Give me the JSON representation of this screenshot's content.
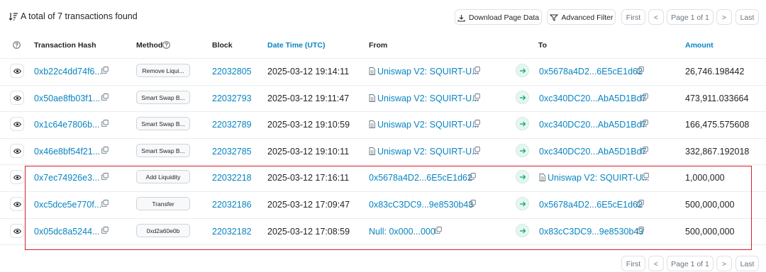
{
  "header": {
    "summary": "A total of 7 transactions found",
    "download_label": "Download Page Data",
    "filter_label": "Advanced Filter",
    "first_label": "First",
    "prev_label": "<",
    "page_label": "Page 1 of 1",
    "next_label": ">",
    "last_label": "Last"
  },
  "columns": {
    "hash": "Transaction Hash",
    "method": "Method",
    "block": "Block",
    "datetime": "Date Time (UTC)",
    "from": "From",
    "to": "To",
    "amount": "Amount"
  },
  "rows": [
    {
      "hash": "0xb22c4dd74f6...",
      "method": "Remove Liqui...",
      "block": "22032805",
      "time": "2025-03-12 19:14:11",
      "from": "Uniswap V2: SQUIRT-U...",
      "from_contract": true,
      "to": "0x5678a4D2...6E5cE1d62",
      "to_contract": false,
      "amount": "26,746.198442"
    },
    {
      "hash": "0x50ae8fb03f1...",
      "method": "Smart Swap B...",
      "block": "22032793",
      "time": "2025-03-12 19:11:47",
      "from": "Uniswap V2: SQUIRT-U...",
      "from_contract": true,
      "to": "0xc340DC20...AbA5D1Bd7",
      "to_contract": false,
      "amount": "473,911.033664"
    },
    {
      "hash": "0x1c64e7806b...",
      "method": "Smart Swap B...",
      "block": "22032789",
      "time": "2025-03-12 19:10:59",
      "from": "Uniswap V2: SQUIRT-U...",
      "from_contract": true,
      "to": "0xc340DC20...AbA5D1Bd7",
      "to_contract": false,
      "amount": "166,475.575608"
    },
    {
      "hash": "0x46e8bf54f21...",
      "method": "Smart Swap B...",
      "block": "22032785",
      "time": "2025-03-12 19:10:11",
      "from": "Uniswap V2: SQUIRT-U...",
      "from_contract": true,
      "to": "0xc340DC20...AbA5D1Bd7",
      "to_contract": false,
      "amount": "332,867.192018"
    },
    {
      "hash": "0x7ec74926e3...",
      "method": "Add Liquidity",
      "block": "22032218",
      "time": "2025-03-12 17:16:11",
      "from": "0x5678a4D2...6E5cE1d62",
      "from_contract": false,
      "to": "Uniswap V2: SQUIRT-U...",
      "to_contract": true,
      "amount": "1,000,000"
    },
    {
      "hash": "0xc5dce5e770f...",
      "method": "Transfer",
      "block": "22032186",
      "time": "2025-03-12 17:09:47",
      "from": "0x83cC3DC9...9e8530b43",
      "from_contract": false,
      "to": "0x5678a4D2...6E5cE1d62",
      "to_contract": false,
      "amount": "500,000,000"
    },
    {
      "hash": "0x05dc8a5244...",
      "method": "0xd2a60e0b",
      "block": "22032182",
      "time": "2025-03-12 17:08:59",
      "from": "Null: 0x000...000",
      "from_contract": false,
      "to": "0x83cC3DC9...9e8530b43",
      "to_contract": false,
      "amount": "500,000,000"
    }
  ],
  "colors": {
    "link": "#0784c3",
    "highlight": "#d91e2b",
    "arrow_bg": "#e6f6ef"
  },
  "icons": [
    "sort-icon",
    "download-icon",
    "filter-icon",
    "eye-icon",
    "copy-icon",
    "question-icon",
    "arrow-right-icon",
    "document-icon"
  ]
}
